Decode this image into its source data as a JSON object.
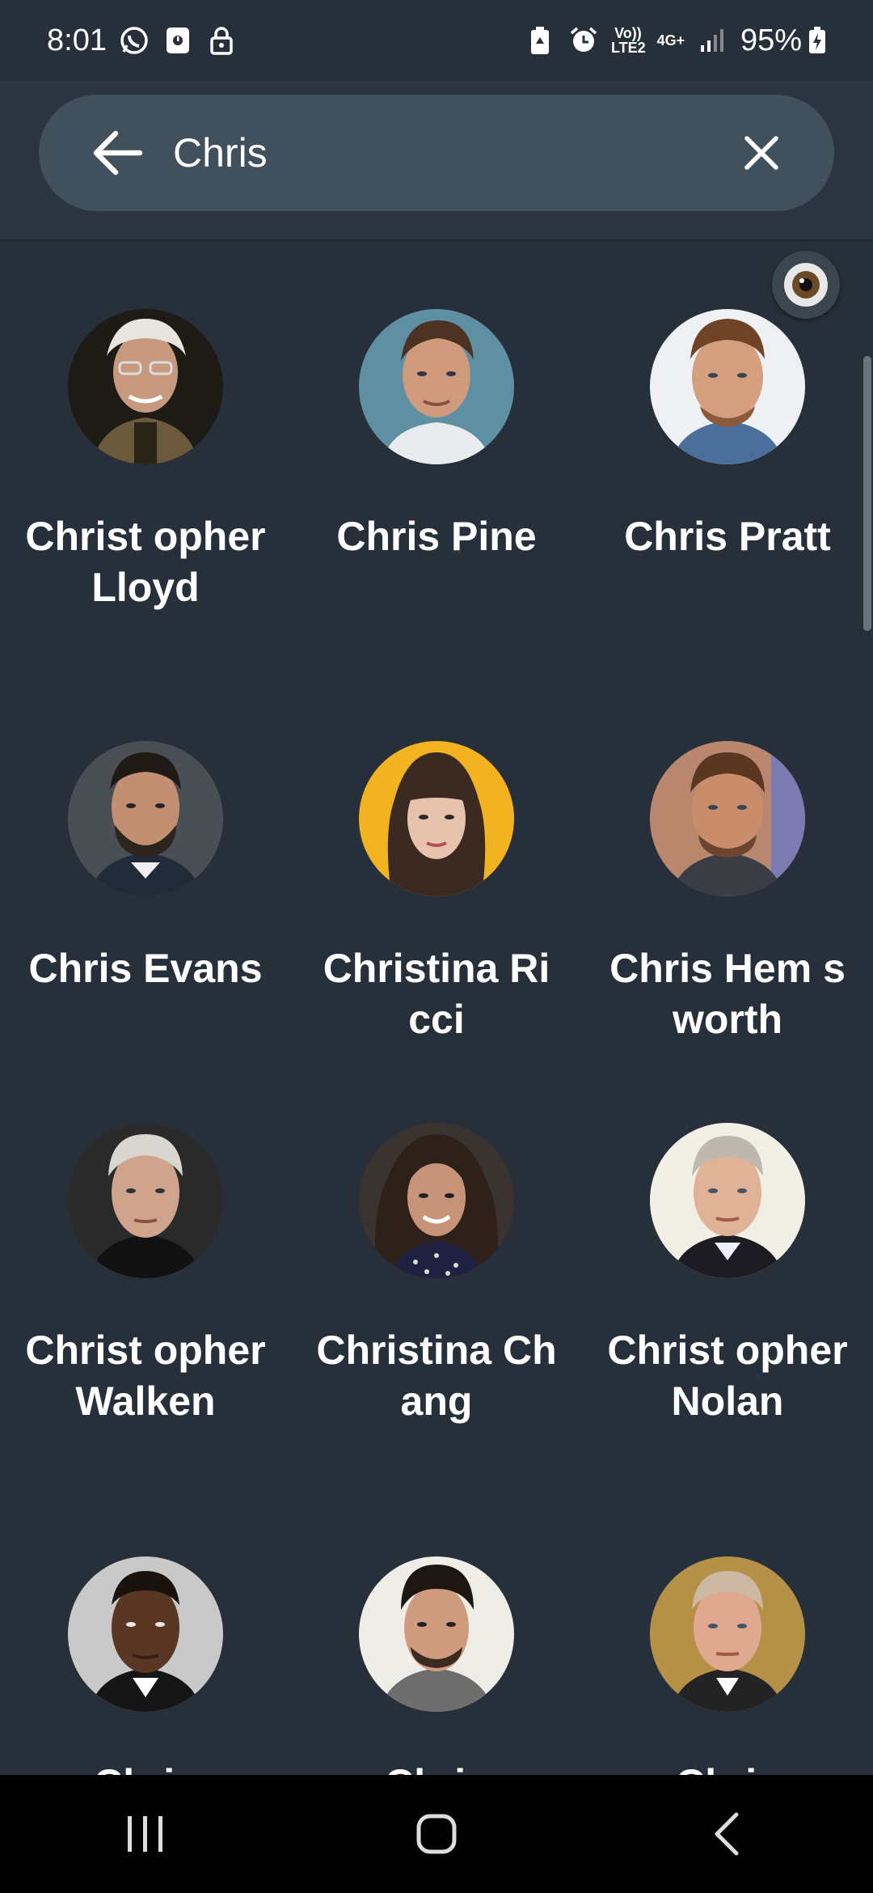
{
  "status_bar": {
    "time": "8:01",
    "left_icons": [
      "whatsapp-icon",
      "notification-icon",
      "lock-icon"
    ],
    "right_icons": [
      "battery-saver-icon",
      "alarm-icon",
      "volte-icon",
      "signal-4g-icon",
      "signal-bars-icon"
    ],
    "volte_text": "Vo)) LTE2",
    "network_text": "4G+",
    "battery_percent": "95%"
  },
  "search": {
    "value": "Chris",
    "back_icon": "arrow-back-icon",
    "clear_icon": "close-icon"
  },
  "results": [
    {
      "name": "Christopher Lloyd",
      "display": "Christ opher Lloyd"
    },
    {
      "name": "Chris Pine",
      "display": "Chris Pine"
    },
    {
      "name": "Chris Pratt",
      "display": "Chris Pratt"
    },
    {
      "name": "Chris Evans",
      "display": "Chris Evans"
    },
    {
      "name": "Christina Ricci",
      "display": "Christina Ricci"
    },
    {
      "name": "Chris Hemsworth",
      "display": "Chris Hem sworth"
    },
    {
      "name": "Christopher Walken",
      "display": "Christ opher Walken"
    },
    {
      "name": "Christina Chang",
      "display": "Christina Chang"
    },
    {
      "name": "Christopher Nolan",
      "display": "Christ opher Nolan"
    },
    {
      "name": "",
      "display": "Chris"
    },
    {
      "name": "",
      "display": "Chris"
    },
    {
      "name": "",
      "display": "Chris"
    }
  ],
  "nav_bar": {
    "recents_icon": "recents-icon",
    "home_icon": "home-icon",
    "back_icon": "back-chevron-icon"
  }
}
